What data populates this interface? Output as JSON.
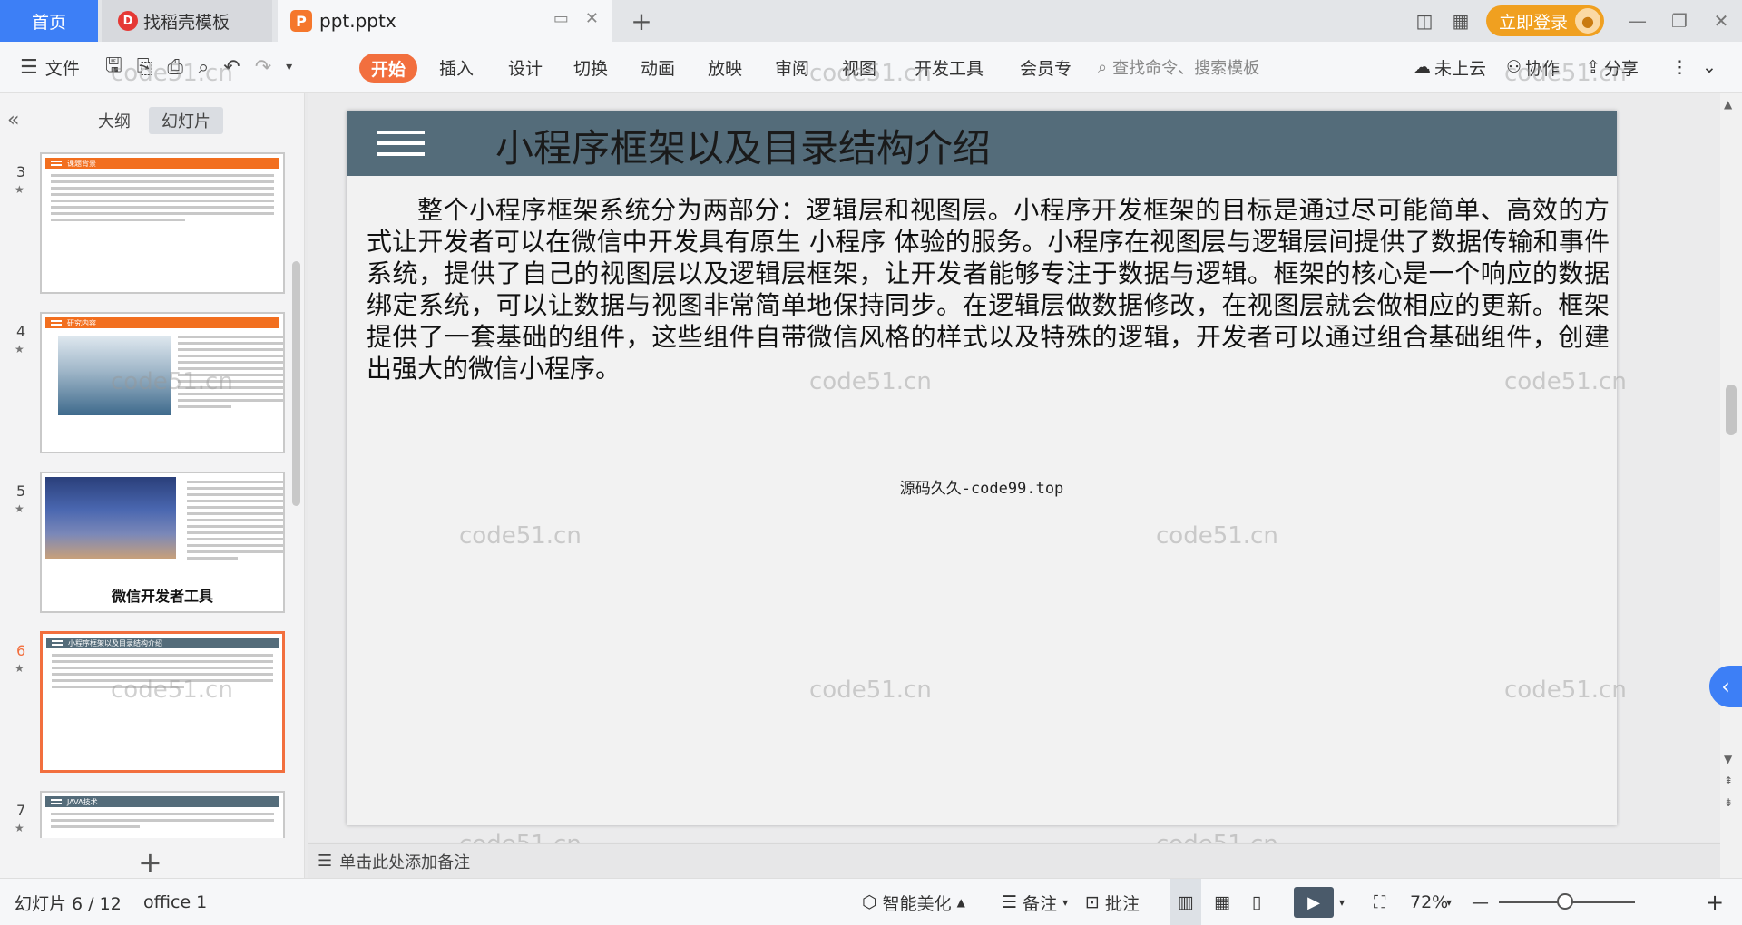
{
  "tabs": {
    "home": "首页",
    "docer": "找稻壳模板",
    "file": "ppt.pptx",
    "add": "+"
  },
  "titlebar": {
    "login": "立即登录"
  },
  "ribbon": {
    "file_menu": "文件",
    "items": [
      "开始",
      "插入",
      "设计",
      "切换",
      "动画",
      "放映",
      "审阅",
      "视图",
      "开发工具",
      "会员专"
    ],
    "search_placeholder": "查找命令、搜索模板",
    "cloud": "未上云",
    "collab": "协作",
    "share": "分享"
  },
  "left_panel": {
    "tab_outline": "大纲",
    "tab_slides": "幻灯片",
    "thumbnails": [
      {
        "num": "3",
        "title": "课题背景",
        "header_color": "#f26f1f"
      },
      {
        "num": "4",
        "title": "研究内容",
        "header_color": "#f26f1f"
      },
      {
        "num": "5",
        "caption": "微信开发者工具"
      },
      {
        "num": "6",
        "title": "小程序框架以及目录结构介绍",
        "header_color": "#546c7a",
        "active": true
      },
      {
        "num": "7",
        "title": "JAVA技术",
        "header_color": "#546c7a"
      }
    ]
  },
  "slide": {
    "title": "小程序框架以及目录结构介绍",
    "body": "整个小程序框架系统分为两部分：逻辑层和视图层。小程序开发框架的目标是通过尽可能简单、高效的方式让开发者可以在微信中开发具有原生 小程序 体验的服务。小程序在视图层与逻辑层间提供了数据传输和事件系统，提供了自己的视图层以及逻辑层框架，让开发者能够专注于数据与逻辑。框架的核心是一个响应的数据绑定系统，可以让数据与视图非常简单地保持同步。在逻辑层做数据修改，在视图层就会做相应的更新。框架提供了一套基础的组件，这些组件自带微信风格的样式以及特殊的逻辑，开发者可以通过组合基础组件，创建出强大的微信小程序。",
    "source": "源码久久-code99.top",
    "header_color": "#546c7a"
  },
  "notes_placeholder": "单击此处添加备注",
  "watermark": "code51.cn",
  "statusbar": {
    "slide_counter": "幻灯片 6 / 12",
    "theme": "office 1",
    "beautify": "智能美化",
    "notes": "备注",
    "comments": "批注",
    "zoom": "72%"
  }
}
